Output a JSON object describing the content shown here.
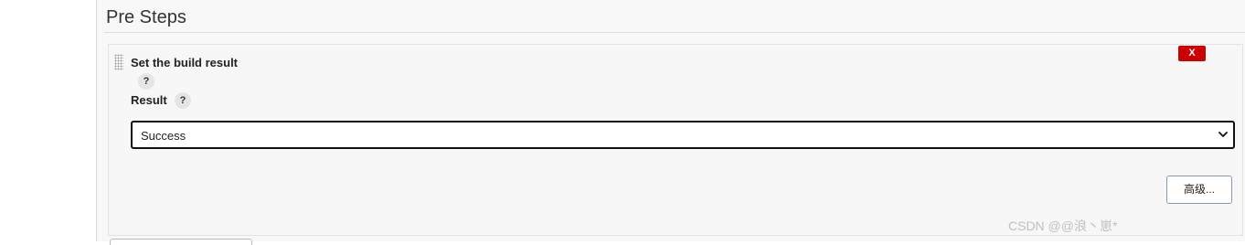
{
  "section": {
    "title": "Pre Steps"
  },
  "step": {
    "title": "Set the build result",
    "help_glyph": "?",
    "delete_label": "X",
    "result_label": "Result",
    "result_help_glyph": "?",
    "result_value": "Success",
    "advanced_label": "高级..."
  },
  "watermark": "CSDN @@浪丶崽*",
  "colors": {
    "delete_button": "#cc0000",
    "panel_background": "#f7f7f7",
    "select_border": "#111111"
  },
  "icons": {
    "drag": "drag-handle-icon",
    "help": "help-icon",
    "dropdown": "chevron-down-icon"
  }
}
